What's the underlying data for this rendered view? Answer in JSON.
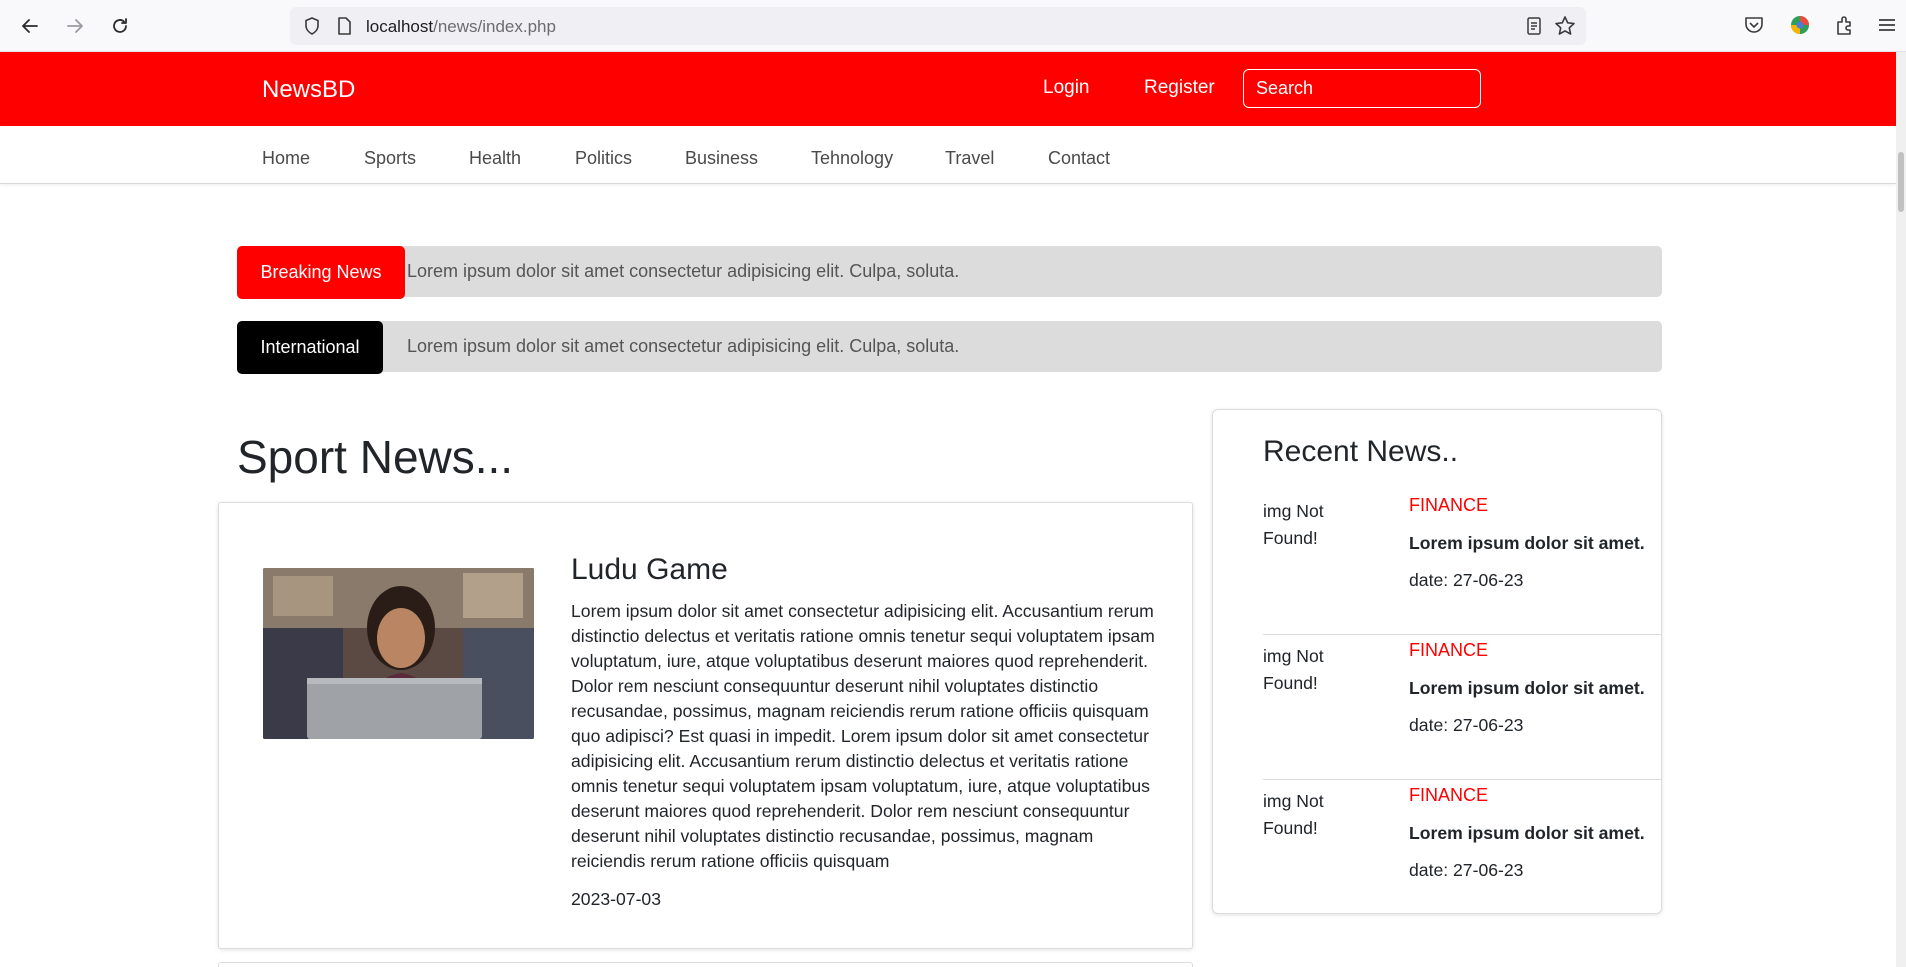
{
  "browser": {
    "url_host": "localhost",
    "url_path": "/news/index.php"
  },
  "header": {
    "brand": "NewsBD",
    "login": "Login",
    "register": "Register",
    "search_placeholder": "Search",
    "accent_color": "#ff0000"
  },
  "nav": {
    "items": [
      "Home",
      "Sports",
      "Health",
      "Politics",
      "Business",
      "Tehnology",
      "Travel",
      "Contact"
    ]
  },
  "tickers": [
    {
      "label": "Breaking News",
      "text": "Lorem ipsum dolor sit amet consectetur adipisicing elit. Culpa, soluta.",
      "color": "#ff0000"
    },
    {
      "label": "International",
      "text": "Lorem ipsum dolor sit amet consectetur adipisicing elit. Culpa, soluta.",
      "color": "#000000"
    }
  ],
  "sport": {
    "section_title": "Sport News...",
    "article": {
      "title": "Ludu Game",
      "body": "Lorem ipsum dolor sit amet consectetur adipisicing elit. Accusantium rerum distinctio delectus et veritatis ratione omnis tenetur sequi voluptatem ipsam voluptatum, iure, atque voluptatibus deserunt maiores quod reprehenderit. Dolor rem nesciunt consequuntur deserunt nihil voluptates distinctio recusandae, possimus, magnam reiciendis rerum ratione officiis quisquam quo adipisci? Est quasi in impedit. Lorem ipsum dolor sit amet consectetur adipisicing elit. Accusantium rerum distinctio delectus et veritatis ratione omnis tenetur sequi voluptatem ipsam voluptatum, iure, atque voluptatibus deserunt maiores quod reprehenderit. Dolor rem nesciunt consequuntur deserunt nihil voluptates distinctio recusandae, possimus, magnam reiciendis rerum ratione officiis quisquam",
      "date": "2023-07-03"
    }
  },
  "recent": {
    "title": "Recent News..",
    "items": [
      {
        "img_alt": "img Not Found!",
        "category": "FINANCE",
        "headline": "Lorem ipsum dolor sit amet.",
        "date": "date: 27-06-23"
      },
      {
        "img_alt": "img Not Found!",
        "category": "FINANCE",
        "headline": "Lorem ipsum dolor sit amet.",
        "date": "date: 27-06-23"
      },
      {
        "img_alt": "img Not Found!",
        "category": "FINANCE",
        "headline": "Lorem ipsum dolor sit amet.",
        "date": "date: 27-06-23"
      }
    ]
  }
}
